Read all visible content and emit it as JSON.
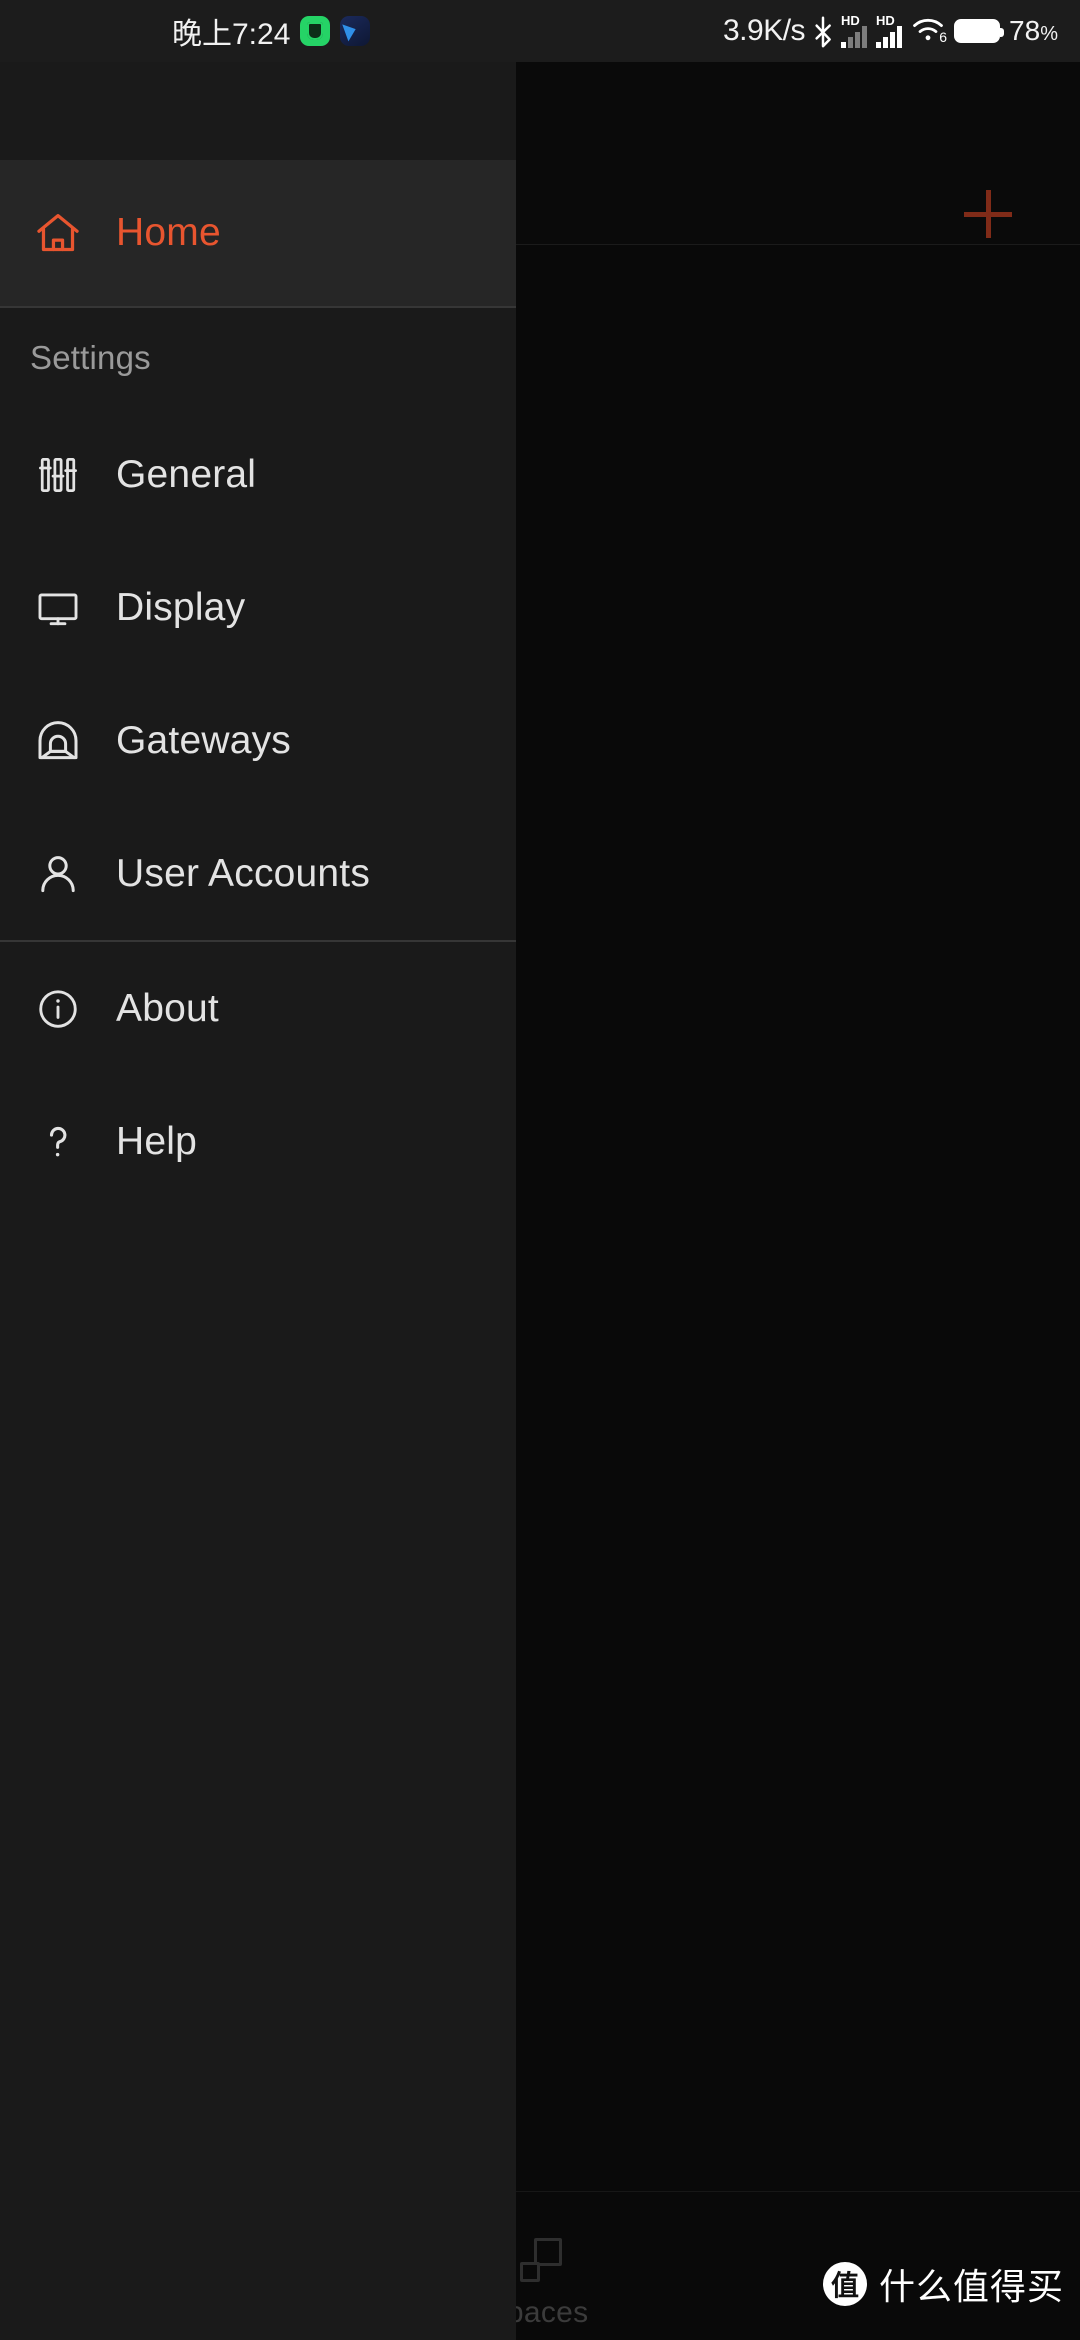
{
  "status_bar": {
    "time": "晚上7:24",
    "app_icons": [
      "green-app-icon",
      "blue-app-icon"
    ],
    "network_speed": "3.9K/s",
    "bluetooth_icon": "bluetooth-icon",
    "sim1_label": "HD",
    "sim2_label": "HD",
    "wifi_icon": "wifi-icon",
    "wifi_generation": "6",
    "battery_percent": "78",
    "battery_percent_symbol": "%"
  },
  "app": {
    "add_button_label": "+",
    "bottom_nav": {
      "items": [
        {
          "label": "spaces",
          "icon": "spaces-icon"
        }
      ]
    }
  },
  "drawer": {
    "primary": {
      "label": "Home",
      "icon": "home-icon",
      "selected": true
    },
    "section_title": "Settings",
    "settings_items": [
      {
        "label": "General",
        "icon": "sliders-icon"
      },
      {
        "label": "Display",
        "icon": "monitor-icon"
      },
      {
        "label": "Gateways",
        "icon": "gateway-arch-icon"
      },
      {
        "label": "User Accounts",
        "icon": "person-icon"
      }
    ],
    "footer_items": [
      {
        "label": "About",
        "icon": "info-circle-icon"
      },
      {
        "label": "Help",
        "icon": "question-mark-icon"
      }
    ]
  },
  "watermark": {
    "logo_char": "值",
    "text": "什么值得买"
  },
  "colors": {
    "accent": "#e8552f",
    "accent_dim": "#a5381f",
    "drawer_bg": "#1a1a1a",
    "selected_bg": "#262626",
    "app_bg": "#0c0c0c",
    "status_bar_bg": "#1c1c1c",
    "text_primary": "#e3e3e3",
    "text_muted": "#9a9a9a"
  }
}
